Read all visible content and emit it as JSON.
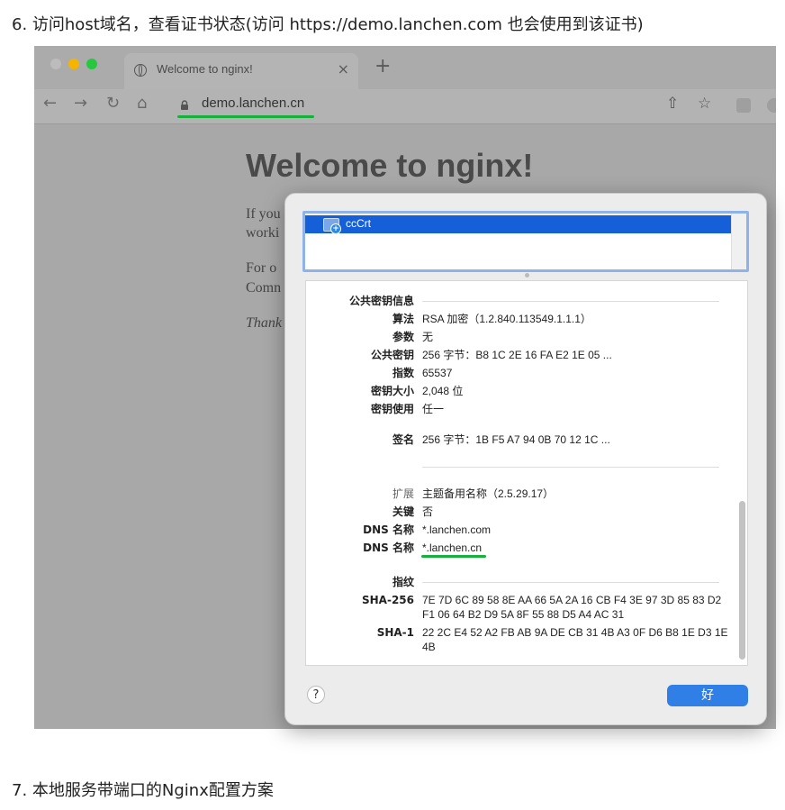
{
  "article": {
    "step6": "6. 访问host域名，查看证书状态(访问 https://demo.lanchen.com 也会使用到该证书)",
    "step7": "7. 本地服务带端口的Nginx配置方案"
  },
  "browser": {
    "tab_title": "Welcome to nginx!",
    "tab_close": "×",
    "new_tab": "+",
    "url": "demo.lanchen.cn",
    "page_heading": "Welcome to nginx!",
    "page_lines": [
      "If you",
      "worki",
      "For o",
      "Comn",
      "Thank"
    ],
    "icons": [
      "back-icon",
      "forward-icon",
      "reload-icon",
      "home-icon",
      "lock-icon",
      "share-icon",
      "star-icon"
    ],
    "nav": {
      "back": "←",
      "forward": "→",
      "reload": "↻",
      "home": "⌂",
      "share": "⇧",
      "star": "☆"
    }
  },
  "dialog": {
    "cert_name": "ccCrt",
    "rows": [
      {
        "key": "公共密钥信息",
        "value": ""
      },
      {
        "key": "算法",
        "value": "RSA 加密（1.2.840.113549.1.1.1）"
      },
      {
        "key": "参数",
        "value": "无"
      },
      {
        "key": "公共密钥",
        "value": "256 字节：B8 1C 2E 16 FA E2 1E 05 ..."
      },
      {
        "key": "指数",
        "value": "65537"
      },
      {
        "key": "密钥大小",
        "value": "2,048 位"
      },
      {
        "key": "密钥使用",
        "value": "任一"
      },
      {
        "key": "签名",
        "value": "256 字节：1B F5 A7 94 0B 70 12 1C ..."
      },
      {
        "key": "扩展",
        "value": "主题备用名称（2.5.29.17）"
      },
      {
        "key": "关键",
        "value": "否"
      },
      {
        "key": "DNS 名称",
        "value": "*.lanchen.com"
      },
      {
        "key": "DNS 名称",
        "value": "*.lanchen.cn"
      },
      {
        "key": "指纹",
        "value": ""
      },
      {
        "key": "SHA-256",
        "value": "7E 7D 6C 89 58 8E AA 66 5A 2A 16 CB F4 3E 97 3D 85 83 D2 F1 06 64 B2 D9 5A 8F 55 88 D5 A4 AC 31"
      },
      {
        "key": "SHA-1",
        "value": "22 2C E4 52 A2 FB AB 9A DE CB 31 4B A3 0F D6 B8 1E D3 1E 4B"
      }
    ],
    "help_label": "?",
    "ok_label": "好"
  },
  "colors": {
    "accent": "#2f7fe6",
    "selection": "#1560d8",
    "annotation": "#16b13a"
  }
}
